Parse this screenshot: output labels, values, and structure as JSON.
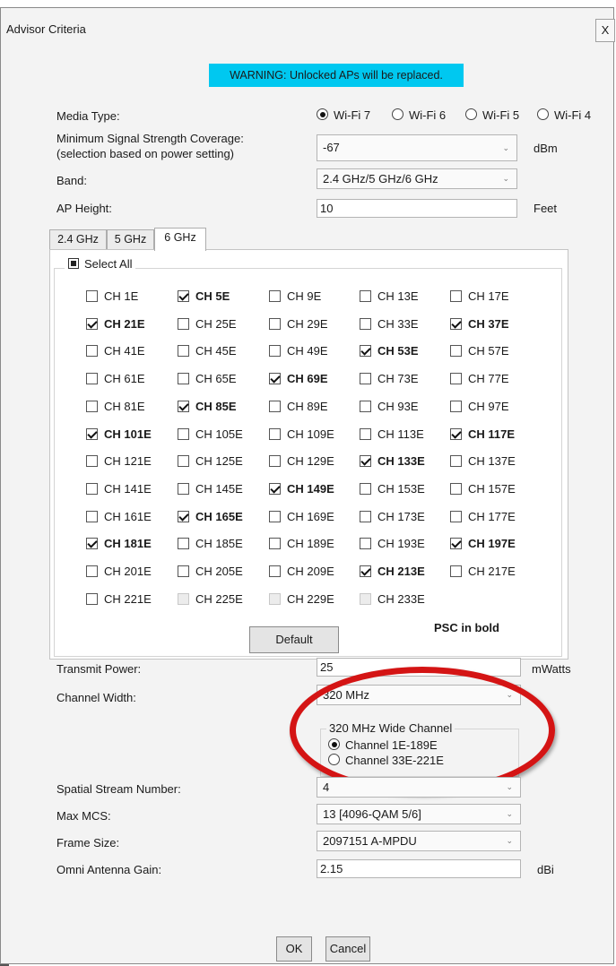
{
  "dialog": {
    "title": "Advisor Criteria",
    "close_label": "X",
    "warning": "WARNING: Unlocked APs will be replaced."
  },
  "media_type": {
    "label": "Media Type:",
    "options": [
      {
        "label": "Wi-Fi 7",
        "selected": true
      },
      {
        "label": "Wi-Fi 6",
        "selected": false
      },
      {
        "label": "Wi-Fi 5",
        "selected": false
      },
      {
        "label": "Wi-Fi 4",
        "selected": false
      }
    ]
  },
  "signal": {
    "label_line1": "Minimum Signal Strength Coverage:",
    "label_line2": "(selection based on power setting)",
    "value": "-67",
    "unit": "dBm"
  },
  "band": {
    "label": "Band:",
    "value": "2.4 GHz/5 GHz/6 GHz"
  },
  "ap_height": {
    "label": "AP Height:",
    "value": "10",
    "unit": "Feet"
  },
  "tabs": [
    {
      "label": "2.4 GHz",
      "active": false
    },
    {
      "label": "5 GHz",
      "active": false
    },
    {
      "label": "6 GHz",
      "active": true
    }
  ],
  "channels": {
    "select_all_label": "Select All",
    "items": [
      {
        "label": "CH 1E",
        "checked": false,
        "bold": false,
        "disabled": false
      },
      {
        "label": "CH 5E",
        "checked": true,
        "bold": true,
        "disabled": false
      },
      {
        "label": "CH 9E",
        "checked": false,
        "bold": false,
        "disabled": false
      },
      {
        "label": "CH 13E",
        "checked": false,
        "bold": false,
        "disabled": false
      },
      {
        "label": "CH 17E",
        "checked": false,
        "bold": false,
        "disabled": false
      },
      {
        "label": "CH 21E",
        "checked": true,
        "bold": true,
        "disabled": false
      },
      {
        "label": "CH 25E",
        "checked": false,
        "bold": false,
        "disabled": false
      },
      {
        "label": "CH 29E",
        "checked": false,
        "bold": false,
        "disabled": false
      },
      {
        "label": "CH 33E",
        "checked": false,
        "bold": false,
        "disabled": false
      },
      {
        "label": "CH 37E",
        "checked": true,
        "bold": true,
        "disabled": false
      },
      {
        "label": "CH 41E",
        "checked": false,
        "bold": false,
        "disabled": false
      },
      {
        "label": "CH 45E",
        "checked": false,
        "bold": false,
        "disabled": false
      },
      {
        "label": "CH 49E",
        "checked": false,
        "bold": false,
        "disabled": false
      },
      {
        "label": "CH 53E",
        "checked": true,
        "bold": true,
        "disabled": false
      },
      {
        "label": "CH 57E",
        "checked": false,
        "bold": false,
        "disabled": false
      },
      {
        "label": "CH 61E",
        "checked": false,
        "bold": false,
        "disabled": false
      },
      {
        "label": "CH 65E",
        "checked": false,
        "bold": false,
        "disabled": false
      },
      {
        "label": "CH 69E",
        "checked": true,
        "bold": true,
        "disabled": false
      },
      {
        "label": "CH 73E",
        "checked": false,
        "bold": false,
        "disabled": false
      },
      {
        "label": "CH 77E",
        "checked": false,
        "bold": false,
        "disabled": false
      },
      {
        "label": "CH 81E",
        "checked": false,
        "bold": false,
        "disabled": false
      },
      {
        "label": "CH 85E",
        "checked": true,
        "bold": true,
        "disabled": false
      },
      {
        "label": "CH 89E",
        "checked": false,
        "bold": false,
        "disabled": false
      },
      {
        "label": "CH 93E",
        "checked": false,
        "bold": false,
        "disabled": false
      },
      {
        "label": "CH 97E",
        "checked": false,
        "bold": false,
        "disabled": false
      },
      {
        "label": "CH 101E",
        "checked": true,
        "bold": true,
        "disabled": false
      },
      {
        "label": "CH 105E",
        "checked": false,
        "bold": false,
        "disabled": false
      },
      {
        "label": "CH 109E",
        "checked": false,
        "bold": false,
        "disabled": false
      },
      {
        "label": "CH 113E",
        "checked": false,
        "bold": false,
        "disabled": false
      },
      {
        "label": "CH 117E",
        "checked": true,
        "bold": true,
        "disabled": false
      },
      {
        "label": "CH 121E",
        "checked": false,
        "bold": false,
        "disabled": false
      },
      {
        "label": "CH 125E",
        "checked": false,
        "bold": false,
        "disabled": false
      },
      {
        "label": "CH 129E",
        "checked": false,
        "bold": false,
        "disabled": false
      },
      {
        "label": "CH 133E",
        "checked": true,
        "bold": true,
        "disabled": false
      },
      {
        "label": "CH 137E",
        "checked": false,
        "bold": false,
        "disabled": false
      },
      {
        "label": "CH 141E",
        "checked": false,
        "bold": false,
        "disabled": false
      },
      {
        "label": "CH 145E",
        "checked": false,
        "bold": false,
        "disabled": false
      },
      {
        "label": "CH 149E",
        "checked": true,
        "bold": true,
        "disabled": false
      },
      {
        "label": "CH 153E",
        "checked": false,
        "bold": false,
        "disabled": false
      },
      {
        "label": "CH 157E",
        "checked": false,
        "bold": false,
        "disabled": false
      },
      {
        "label": "CH 161E",
        "checked": false,
        "bold": false,
        "disabled": false
      },
      {
        "label": "CH 165E",
        "checked": true,
        "bold": true,
        "disabled": false
      },
      {
        "label": "CH 169E",
        "checked": false,
        "bold": false,
        "disabled": false
      },
      {
        "label": "CH 173E",
        "checked": false,
        "bold": false,
        "disabled": false
      },
      {
        "label": "CH 177E",
        "checked": false,
        "bold": false,
        "disabled": false
      },
      {
        "label": "CH 181E",
        "checked": true,
        "bold": true,
        "disabled": false
      },
      {
        "label": "CH 185E",
        "checked": false,
        "bold": false,
        "disabled": false
      },
      {
        "label": "CH 189E",
        "checked": false,
        "bold": false,
        "disabled": false
      },
      {
        "label": "CH 193E",
        "checked": false,
        "bold": false,
        "disabled": false
      },
      {
        "label": "CH 197E",
        "checked": true,
        "bold": true,
        "disabled": false
      },
      {
        "label": "CH 201E",
        "checked": false,
        "bold": false,
        "disabled": false
      },
      {
        "label": "CH 205E",
        "checked": false,
        "bold": false,
        "disabled": false
      },
      {
        "label": "CH 209E",
        "checked": false,
        "bold": false,
        "disabled": false
      },
      {
        "label": "CH 213E",
        "checked": true,
        "bold": true,
        "disabled": false
      },
      {
        "label": "CH 217E",
        "checked": false,
        "bold": false,
        "disabled": false
      },
      {
        "label": "CH 221E",
        "checked": false,
        "bold": false,
        "disabled": false
      },
      {
        "label": "CH 225E",
        "checked": false,
        "bold": false,
        "disabled": true
      },
      {
        "label": "CH 229E",
        "checked": false,
        "bold": false,
        "disabled": true
      },
      {
        "label": "CH 233E",
        "checked": false,
        "bold": false,
        "disabled": true
      }
    ],
    "default_button": "Default",
    "psc_note": "PSC in bold"
  },
  "transmit_power": {
    "label": "Transmit Power:",
    "value": "25",
    "unit": "mWatts"
  },
  "channel_width": {
    "label": "Channel Width:",
    "value": "320 MHz",
    "wide_channel": {
      "legend": "320 MHz Wide Channel",
      "options": [
        {
          "label": "Channel 1E-189E",
          "selected": true
        },
        {
          "label": "Channel 33E-221E",
          "selected": false
        }
      ]
    }
  },
  "spatial_stream": {
    "label": "Spatial Stream Number:",
    "value": "4"
  },
  "max_mcs": {
    "label": "Max MCS:",
    "value": "13 [4096-QAM 5/6]"
  },
  "frame_size": {
    "label": "Frame Size:",
    "value": "2097151 A-MPDU"
  },
  "antenna_gain": {
    "label": "Omni Antenna Gain:",
    "value": "2.15",
    "unit": "dBi"
  },
  "footer": {
    "ok": "OK",
    "cancel": "Cancel"
  },
  "colors": {
    "warning_bg": "#00c8f0",
    "highlight_ellipse": "#d41414"
  }
}
